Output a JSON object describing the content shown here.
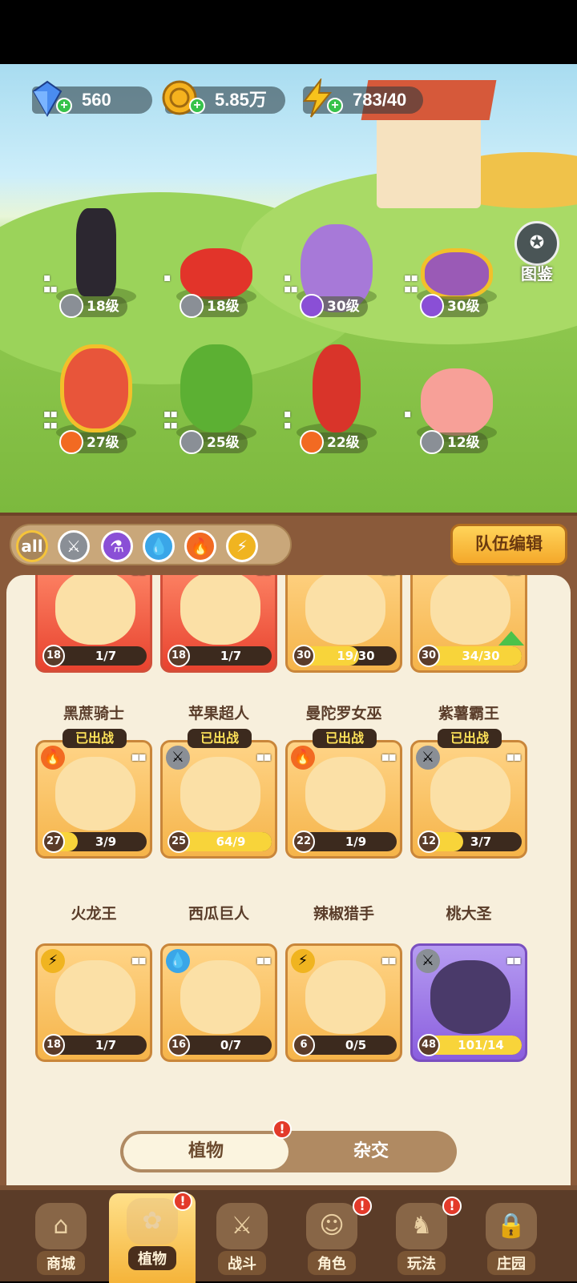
{
  "resources": [
    {
      "icon": "diamond-icon",
      "value": "560"
    },
    {
      "icon": "gold-coin-icon",
      "value": "5.85万"
    },
    {
      "icon": "lightning-energy-icon",
      "value": "783/40"
    }
  ],
  "codex_label": "图鉴",
  "team": [
    {
      "name": "黑蔗骑士",
      "element": "sword",
      "level": "18级"
    },
    {
      "name": "苹果超人",
      "element": "sword",
      "level": "18级"
    },
    {
      "name": "曼陀罗女巫",
      "element": "potion",
      "level": "30级"
    },
    {
      "name": "紫薯霸王",
      "element": "potion",
      "level": "30级"
    },
    {
      "name": "火龙王",
      "element": "fire",
      "level": "27级"
    },
    {
      "name": "西瓜巨人",
      "element": "sword",
      "level": "25级"
    },
    {
      "name": "辣椒猎手",
      "element": "fire",
      "level": "22级"
    },
    {
      "name": "桃大圣",
      "element": "sword",
      "level": "12级"
    }
  ],
  "filters": [
    {
      "label": "all",
      "icon": "all-icon"
    },
    {
      "label": "",
      "icon": "sword-icon"
    },
    {
      "label": "",
      "icon": "potion-icon"
    },
    {
      "label": "",
      "icon": "water-drop-icon"
    },
    {
      "label": "",
      "icon": "fire-icon"
    },
    {
      "label": "",
      "icon": "lightning-icon"
    }
  ],
  "team_edit_label": "队伍编辑",
  "deployed_label": "已出战",
  "cards": [
    {
      "name": "黑蔗骑士",
      "level": "18",
      "progress": "1/7",
      "fill": 0.14,
      "color": "red"
    },
    {
      "name": "苹果超人",
      "level": "18",
      "progress": "1/7",
      "fill": 0.14,
      "color": "red"
    },
    {
      "name": "曼陀罗女巫",
      "level": "30",
      "progress": "19/30",
      "fill": 0.63,
      "color": "gold"
    },
    {
      "name": "紫薯霸王",
      "level": "30",
      "progress": "34/30",
      "fill": 1,
      "color": "gold",
      "upgrade": true
    },
    {
      "name": "火龙王",
      "level": "27",
      "progress": "3/9",
      "fill": 0.33,
      "color": "gold",
      "deployed": true,
      "element": "fire-icon"
    },
    {
      "name": "西瓜巨人",
      "level": "25",
      "progress": "64/9",
      "fill": 1,
      "color": "gold",
      "deployed": true,
      "element": "sword-icon"
    },
    {
      "name": "辣椒猎手",
      "level": "22",
      "progress": "1/9",
      "fill": 0.11,
      "color": "gold",
      "deployed": true,
      "element": "fire-icon"
    },
    {
      "name": "桃大圣",
      "level": "12",
      "progress": "3/7",
      "fill": 0.43,
      "color": "gold",
      "deployed": true,
      "element": "sword-icon"
    },
    {
      "name": "",
      "level": "18",
      "progress": "1/7",
      "fill": 0.14,
      "color": "gold",
      "element": "lightning-icon"
    },
    {
      "name": "",
      "level": "16",
      "progress": "0/7",
      "fill": 0,
      "color": "gold",
      "element": "water-drop-icon"
    },
    {
      "name": "",
      "level": "6",
      "progress": "0/5",
      "fill": 0,
      "color": "gold",
      "element": "lightning-icon"
    },
    {
      "name": "",
      "level": "48",
      "progress": "101/14",
      "fill": 1,
      "color": "purple",
      "element": "sword-icon"
    }
  ],
  "toggle": {
    "plant": "植物",
    "hybrid": "杂交",
    "alert": "!"
  },
  "nav": [
    {
      "label": "商城",
      "icon": "shop-icon"
    },
    {
      "label": "植物",
      "icon": "plants-icon",
      "alert": "!"
    },
    {
      "label": "战斗",
      "icon": "battle-icon"
    },
    {
      "label": "角色",
      "icon": "character-icon",
      "alert": "!"
    },
    {
      "label": "玩法",
      "icon": "gameplay-icon",
      "alert": "!"
    },
    {
      "label": "庄园",
      "icon": "lock-icon"
    }
  ],
  "colors": {
    "accent": "#f5b43a",
    "panel": "#8a5a3a",
    "cream": "#f7efdc",
    "fire": "#f26a22",
    "sword": "#8a8f96",
    "potion": "#8a4fd6",
    "water": "#3aa6e8",
    "lightning": "#f0b420"
  }
}
